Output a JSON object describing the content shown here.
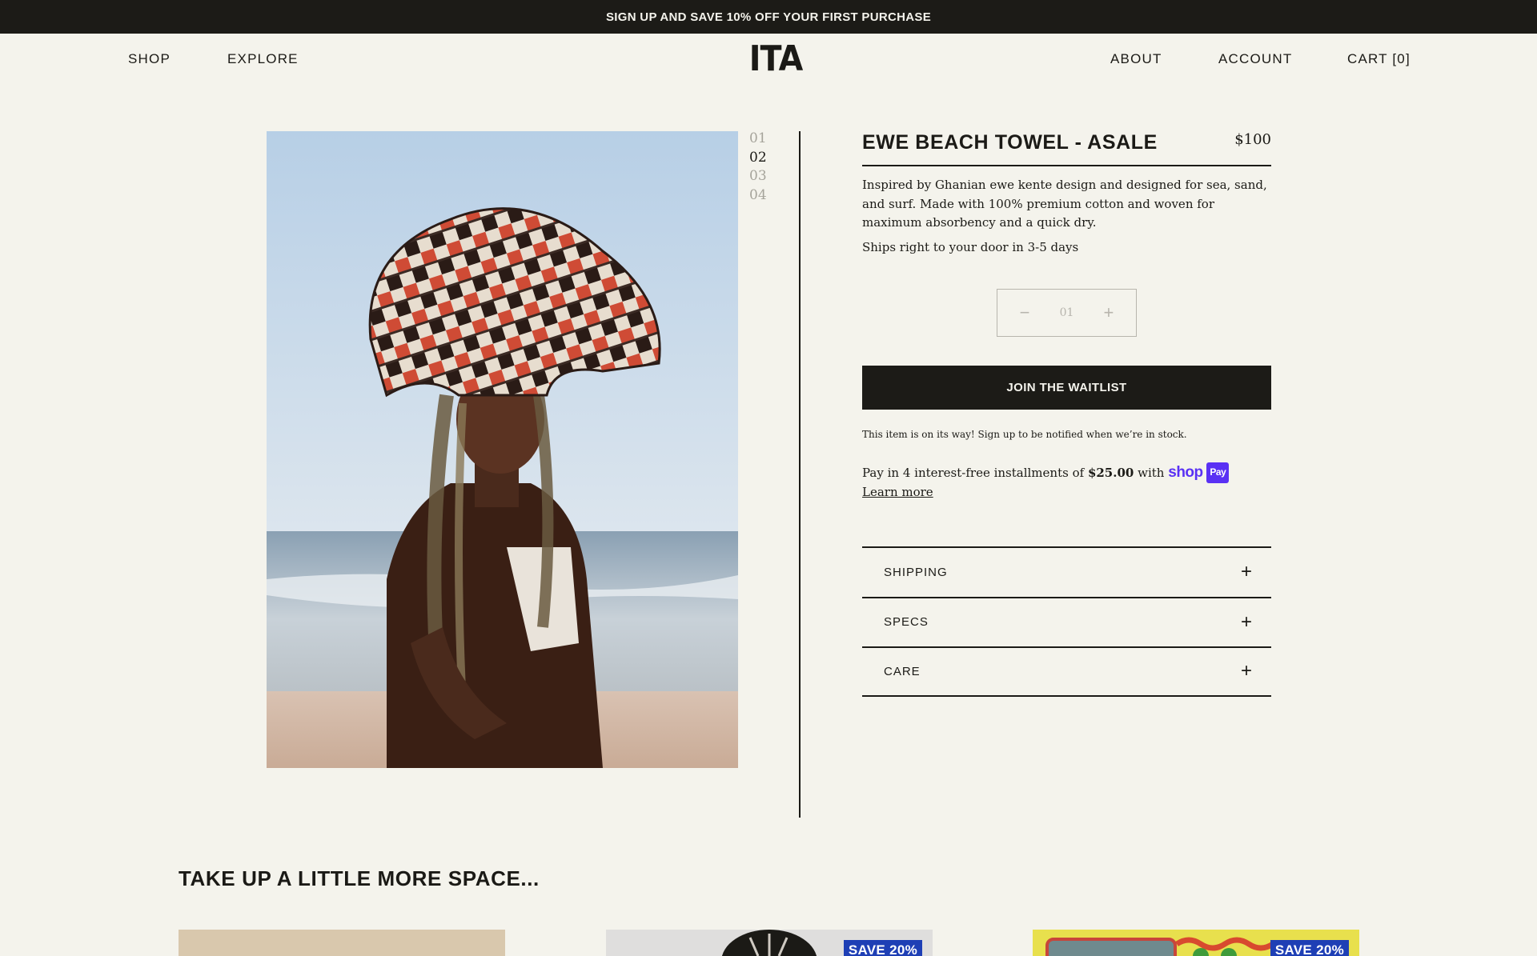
{
  "announcement": "SIGN UP AND SAVE 10% OFF YOUR FIRST PURCHASE",
  "header": {
    "nav_left": [
      "SHOP",
      "EXPLORE"
    ],
    "logo": "ITA",
    "nav_right": [
      "ABOUT",
      "ACCOUNT",
      "CART [0]"
    ]
  },
  "gallery": {
    "thumbs": [
      "01",
      "02",
      "03",
      "04"
    ],
    "active_index": 1
  },
  "product": {
    "title": "EWE BEACH TOWEL - ASALE",
    "price": "$100",
    "description": "Inspired by Ghanian ewe kente design and designed for sea, sand, and surf. Made with 100% premium cotton and woven for maximum absorbency and a quick dry.",
    "shipping_note": "Ships right to your door in 3-5 days",
    "quantity": {
      "minus": "−",
      "value": "01",
      "plus": "+"
    },
    "cta_label": "JOIN THE WAITLIST",
    "stock_note": "This item is on its way! Sign up to be notified when we’re in stock.",
    "installments": {
      "prefix": "Pay in 4 interest-free installments of",
      "amount": "$25.00",
      "with": "with",
      "shop_logo": "shop",
      "pay_badge": "Pay",
      "learn_more": "Learn more"
    },
    "accordion": [
      {
        "label": "SHIPPING",
        "icon": "+"
      },
      {
        "label": "SPECS",
        "icon": "+"
      },
      {
        "label": "CARE",
        "icon": "+"
      }
    ]
  },
  "recommendations": {
    "title": "TAKE UP A LITTLE MORE SPACE...",
    "cards": [
      {
        "badge": ""
      },
      {
        "badge": "SAVE 20%"
      },
      {
        "badge": "SAVE 20%"
      }
    ]
  },
  "colors": {
    "background": "#f4f3ec",
    "ink": "#1b1a16",
    "dark_bar": "#1c1b17",
    "shop_pay": "#5a31f4",
    "save_badge": "#1e3fb5"
  }
}
